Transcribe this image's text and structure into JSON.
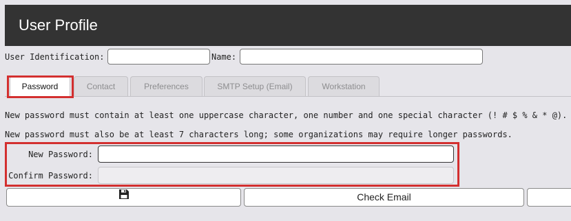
{
  "header": {
    "title": "User Profile"
  },
  "identity": {
    "user_id_label": "User Identification:",
    "user_id_value": "",
    "name_label": "Name:",
    "name_value": ""
  },
  "tabs": [
    {
      "label": "Password",
      "active": true
    },
    {
      "label": "Contact",
      "active": false
    },
    {
      "label": "Preferences",
      "active": false
    },
    {
      "label": "SMTP Setup (Email)",
      "active": false
    },
    {
      "label": "Workstation",
      "active": false
    }
  ],
  "password": {
    "rule1": "New password must contain at least one uppercase character, one number and one special character (! # $ % & * @).",
    "rule2": "New password must also be at least 7 characters long; some organizations may require longer passwords.",
    "new_label": "New Password:",
    "new_value": "",
    "confirm_label": "Confirm Password:",
    "confirm_value": ""
  },
  "buttons": {
    "save_icon": "floppy-disk-icon",
    "check_email_label": "Check Email",
    "third_label": ""
  },
  "colors": {
    "header_bg": "#333333",
    "highlight": "#d32f2f",
    "page_bg": "#e6e5ea"
  }
}
